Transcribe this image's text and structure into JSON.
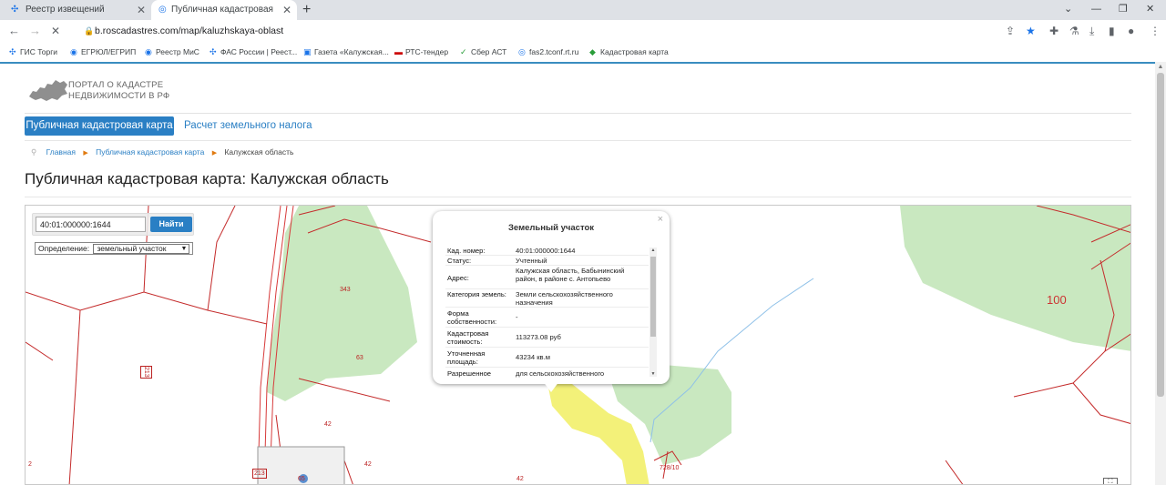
{
  "browser": {
    "tabs": [
      {
        "title": "Реестр извещений",
        "close": "✕",
        "favicon": "✣"
      },
      {
        "title": "Публичная кадастровая карта: К",
        "close": "✕",
        "favicon": "◎"
      }
    ],
    "new_tab": "+",
    "window_controls": {
      "minimize": "⌄",
      "min2": "—",
      "restore": "❐",
      "close": "✕"
    },
    "address": "b.roscadastres.com/map/kaluzhskaya-oblast",
    "nav": {
      "back": "←",
      "forward": "→",
      "reload": "✕"
    },
    "bookmarks": [
      {
        "label": "ГИС Торги",
        "icon": "✣"
      },
      {
        "label": "ЕГРЮЛ/ЕГРИП",
        "icon": "◉"
      },
      {
        "label": "Реестр МиС",
        "icon": "◉"
      },
      {
        "label": "ФАС России | Реест...",
        "icon": "✣"
      },
      {
        "label": "Газета «Калужская...",
        "icon": "▣"
      },
      {
        "label": "РТС-тендер",
        "icon": "▬"
      },
      {
        "label": "Сбер АСТ",
        "icon": "✓"
      },
      {
        "label": "fas2.tconf.rt.ru",
        "icon": "◎"
      },
      {
        "label": "Кадастровая карта",
        "icon": "◆"
      }
    ]
  },
  "site": {
    "logo_line1": "ПОРТАЛ О КАДАСТРЕ",
    "logo_line2": "НЕДВИЖИМОСТИ В РФ",
    "nav_active": "Публичная кадастровая карта",
    "nav_other": "Расчет земельного налога",
    "breadcrumb": [
      "Главная",
      "Публичная кадастровая карта",
      "Калужская область"
    ],
    "page_title": "Публичная кадастровая карта: Калужская область"
  },
  "map": {
    "search_value": "40:01:000000:1644",
    "search_button": "Найти",
    "definition_label": "Определение:",
    "definition_value": "земельный участок",
    "labels": [
      "343",
      "63",
      "42",
      "42",
      "42",
      "213",
      "65",
      "2",
      "100",
      "728/10",
      "213"
    ],
    "fullscreen_icon": "⛶"
  },
  "popup": {
    "title": "Земельный участок",
    "close": "×",
    "rows": [
      {
        "k": "Кад. номер:",
        "v": "40:01:000000:1644"
      },
      {
        "k": "Статус:",
        "v": "Учтенный"
      },
      {
        "k": "Адрес:",
        "v": "Калужская область, Бабынинский район, в районе с. Антопьево"
      },
      {
        "k": "Категория земель:",
        "v": "Земли сельскохозяйственного назначения"
      },
      {
        "k": "Форма собственности:",
        "v": "-"
      },
      {
        "k": "Кадастровая стоимость:",
        "v": "113273.08 руб"
      },
      {
        "k": "Уточненная площадь:",
        "v": "43234 кв.м"
      },
      {
        "k": "Разрешенное",
        "v": "для сельскохозяйственного"
      }
    ]
  }
}
